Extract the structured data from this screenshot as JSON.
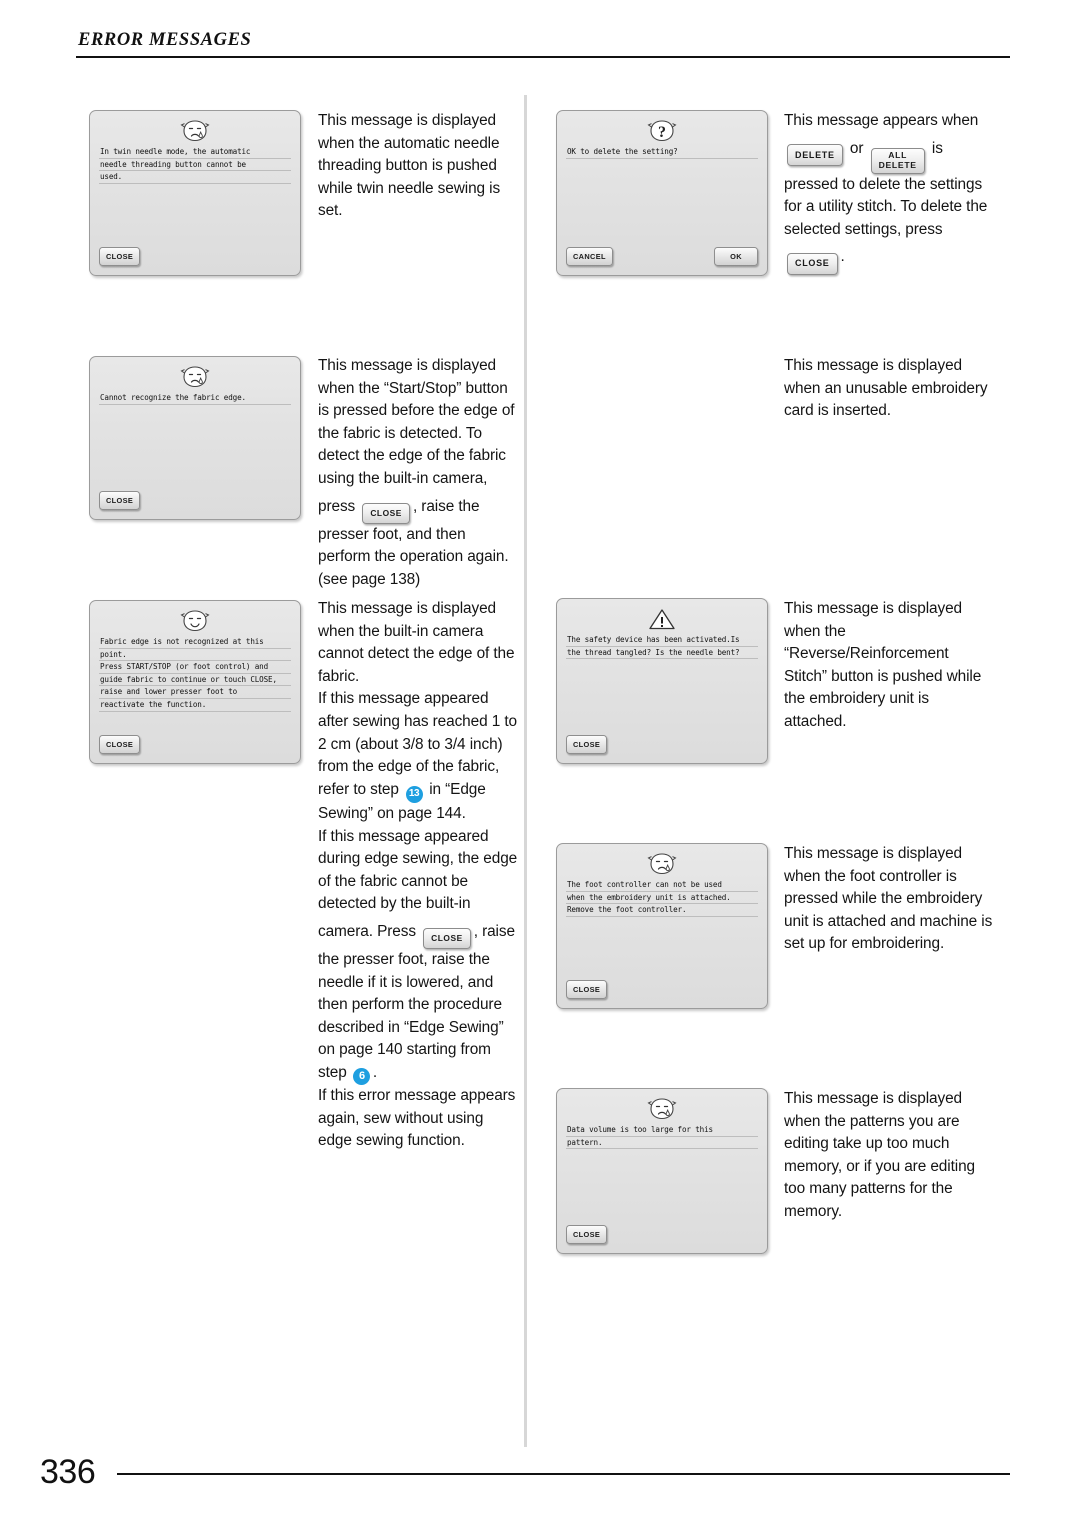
{
  "page": {
    "header_title": "ERROR MESSAGES",
    "folio": "336",
    "accent_blue": "#1e9fe0",
    "lcd_background": "#e4e4e4"
  },
  "common": {
    "close_label": "CLOSE",
    "cancel_label": "CANCEL",
    "ok_label": "OK",
    "delete_label": "DELETE",
    "all_delete_line1": "ALL",
    "all_delete_line2": "DELETE"
  },
  "left_page": {
    "entries": [
      {
        "dialog": {
          "icon": "sad-face-icon",
          "lines": [
            "In twin needle mode,  the automatic",
            "needle threading button cannot be",
            "used."
          ],
          "buttons": [
            "CLOSE"
          ]
        },
        "text": {
          "paragraphs": [
            "This message is displayed when the automatic needle threading button is pushed while twin needle sewing is set."
          ]
        }
      },
      {
        "dialog": {
          "icon": "sad-face-icon",
          "lines": [
            "Cannot recognize the fabric edge."
          ],
          "buttons": [
            "CLOSE"
          ]
        },
        "text": {
          "part1": "This message is displayed when the “Start/Stop” button is pressed before the edge of the fabric is detected. To detect the edge of the fabric using the built-in camera,",
          "press_word": "press",
          "inline_button": "CLOSE",
          "part2": ", raise the",
          "part3": "presser foot, and then perform the operation again. (see page 138)"
        }
      },
      {
        "dialog": {
          "icon": "smile-face-icon",
          "lines": [
            "Fabric edge is not recognized at this",
            "point.",
            "Press START/STOP (or  foot control) and",
            "guide fabric to continue or touch CLOSE,",
            "raise and lower  presser foot to",
            "reactivate the function."
          ],
          "buttons": [
            "CLOSE"
          ]
        },
        "text": {
          "part1": "This message is displayed when the built-in camera cannot detect the edge of the fabric.",
          "part2": "If this message appeared after sewing has reached 1 to 2 cm (about 3/8 to 3/4 inch) from the edge of the fabric, refer to step",
          "step_badge_1": "13",
          "part3": "in “Edge Sewing” on page 144.",
          "part4": "If this message appeared during edge sewing, the edge of the fabric cannot be detected by the built-in",
          "part5": "camera. Press",
          "inline_button": "CLOSE",
          "part6": ", raise",
          "part7": "the presser foot, raise the needle if it is lowered, and then perform the procedure described in “Edge Sewing” on page 140 starting from",
          "step_word": "step",
          "step_badge_2": "6",
          "part8": ".",
          "part9": "If this error message appears again, sew without using edge sewing function."
        }
      }
    ]
  },
  "right_page": {
    "entries": [
      {
        "dialog": {
          "icon": "question-face-icon",
          "lines": [
            "OK to delete the setting?"
          ],
          "buttons": [
            "CANCEL",
            "OK"
          ]
        },
        "text": {
          "part1": "This message appears when",
          "btn_delete": "DELETE",
          "or_word": "or",
          "btn_all_delete_l1": "ALL",
          "btn_all_delete_l2": "DELETE",
          "is_word": "is",
          "part2": "pressed to delete the settings for a utility stitch. To delete the selected settings, press",
          "btn_close": "CLOSE",
          "part3": "."
        }
      },
      {
        "dialog": null,
        "text": {
          "paragraphs": [
            "This message is displayed when an unusable embroidery card is inserted."
          ]
        }
      },
      {
        "dialog": {
          "icon": "warning-triangle-icon",
          "lines": [
            "The safety device has been activated.Is",
            "the thread tangled? Is the needle bent?"
          ],
          "buttons": [
            "CLOSE"
          ]
        },
        "text": {
          "paragraphs": [
            "This message is displayed when the “Reverse/Reinforcement Stitch” button is pushed while the embroidery unit is attached."
          ]
        }
      },
      {
        "dialog": {
          "icon": "sad-face-icon",
          "lines": [
            "The foot controller can not be used",
            "when the embroidery unit is attached.",
            "Remove the foot controller."
          ],
          "buttons": [
            "CLOSE"
          ]
        },
        "text": {
          "paragraphs": [
            "This message is displayed when the foot controller is pressed while the embroidery unit is attached and machine is set up for embroidering."
          ]
        }
      },
      {
        "dialog": {
          "icon": "sad-face-icon",
          "lines": [
            "Data volume is too large for this",
            "pattern."
          ],
          "buttons": [
            "CLOSE"
          ]
        },
        "text": {
          "paragraphs": [
            "This message is displayed when the patterns you are editing take up too much memory, or if you are editing too many patterns for the memory."
          ]
        }
      }
    ]
  }
}
